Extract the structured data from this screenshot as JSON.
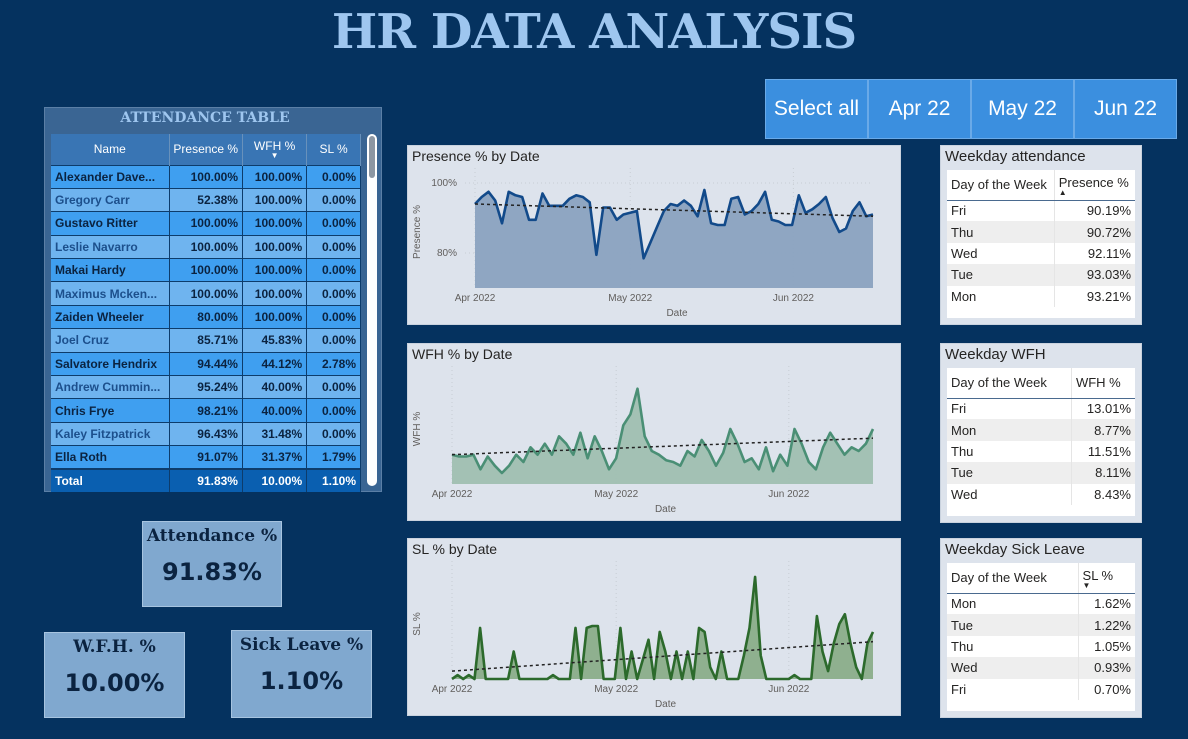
{
  "title": "HR DATA ANALYSIS",
  "slicer": [
    "Select all",
    "Apr 22",
    "May 22",
    "Jun 22"
  ],
  "attendance_table": {
    "title": "ATTENDANCE TABLE",
    "headers": [
      "Name",
      "Presence %",
      "WFH %",
      "SL %"
    ],
    "rows": [
      [
        "Alexander Dave...",
        "100.00%",
        "100.00%",
        "0.00%"
      ],
      [
        "Gregory Carr",
        "52.38%",
        "100.00%",
        "0.00%"
      ],
      [
        "Gustavo Ritter",
        "100.00%",
        "100.00%",
        "0.00%"
      ],
      [
        "Leslie Navarro",
        "100.00%",
        "100.00%",
        "0.00%"
      ],
      [
        "Makai Hardy",
        "100.00%",
        "100.00%",
        "0.00%"
      ],
      [
        "Maximus Mcken...",
        "100.00%",
        "100.00%",
        "0.00%"
      ],
      [
        "Zaiden Wheeler",
        "80.00%",
        "100.00%",
        "0.00%"
      ],
      [
        "Joel Cruz",
        "85.71%",
        "45.83%",
        "0.00%"
      ],
      [
        "Salvatore Hendrix",
        "94.44%",
        "44.12%",
        "2.78%"
      ],
      [
        "Andrew Cummin...",
        "95.24%",
        "40.00%",
        "0.00%"
      ],
      [
        "Chris Frye",
        "98.21%",
        "40.00%",
        "0.00%"
      ],
      [
        "Kaley Fitzpatrick",
        "96.43%",
        "31.48%",
        "0.00%"
      ],
      [
        "Ella Roth",
        "91.07%",
        "31.37%",
        "1.79%"
      ]
    ],
    "total": [
      "Total",
      "91.83%",
      "10.00%",
      "1.10%"
    ]
  },
  "kpis": {
    "attendance": {
      "label": "Attendance %",
      "value": "91.83%"
    },
    "wfh": {
      "label": "W.F.H. %",
      "value": "10.00%"
    },
    "sick": {
      "label": "Sick Leave %",
      "value": "1.10%"
    }
  },
  "chart_data": [
    {
      "type": "area",
      "title": "Presence % by Date",
      "xlabel": "Date",
      "ylabel": "Presence %",
      "x_ticks": [
        "Apr 2022",
        "May 2022",
        "Jun 2022"
      ],
      "y_ticks": [
        "100%",
        "80%"
      ],
      "ylim": [
        70,
        102
      ],
      "color": "#124a8a",
      "fill": "#8aa2c0",
      "trend": [
        94,
        90.5
      ],
      "values": [
        94,
        96,
        97.5,
        95,
        88.5,
        97.5,
        96.5,
        96,
        89.5,
        89.5,
        97,
        93.5,
        93.5,
        93.5,
        95.5,
        96.5,
        96,
        94.5,
        79.5,
        93,
        93,
        89.5,
        91,
        91.5,
        92,
        78.5,
        83,
        87.5,
        92,
        94,
        93.5,
        95,
        93.5,
        90.5,
        98,
        88.5,
        88,
        88,
        95.5,
        96,
        91,
        92,
        94,
        97.5,
        89.5,
        89,
        88,
        88,
        96.5,
        91.5,
        92.5,
        94,
        96,
        90,
        86,
        87,
        92,
        94.5,
        90.5,
        91
      ]
    },
    {
      "type": "area",
      "title": "WFH % by Date",
      "xlabel": "Date",
      "ylabel": "WFH %",
      "x_ticks": [
        "Apr 2022",
        "May 2022",
        "Jun 2022"
      ],
      "ylim": [
        0,
        30
      ],
      "color": "#4a8f75",
      "fill": "#9fbfb1",
      "trend": [
        8,
        12.5
      ],
      "values": [
        8,
        7.5,
        7.5,
        8,
        4,
        7.5,
        5,
        3,
        5,
        8,
        6,
        10,
        8,
        11,
        8,
        13,
        11,
        8,
        14,
        7,
        13,
        9,
        4,
        7,
        16,
        19,
        26,
        13,
        9,
        8,
        6.5,
        6,
        5,
        9,
        7.5,
        12,
        9,
        5,
        8.5,
        15,
        11,
        6,
        7,
        4,
        10,
        3.5,
        8,
        5,
        15,
        11,
        6,
        4,
        10,
        14,
        11,
        8,
        10,
        9,
        11,
        15
      ]
    },
    {
      "type": "area",
      "title": "SL % by Date",
      "xlabel": "Date",
      "ylabel": "SL %",
      "x_ticks": [
        "Apr 2022",
        "May 2022",
        "Jun 2022"
      ],
      "ylim": [
        0,
        2.8
      ],
      "color": "#2c6a2c",
      "fill": "#8aad8a",
      "trend": [
        0.2,
        0.95
      ],
      "values": [
        0,
        0.1,
        0,
        0.1,
        0,
        1.3,
        0,
        0,
        0,
        0,
        0,
        0.7,
        0,
        0,
        0,
        0,
        0,
        0,
        0.1,
        0,
        0,
        0,
        1.3,
        0,
        1.3,
        1.35,
        1.35,
        0,
        0,
        0,
        1.3,
        0,
        0.7,
        0,
        0.5,
        1.0,
        0,
        1.2,
        0.7,
        0,
        0.7,
        0,
        0.7,
        0,
        1.3,
        1.2,
        0.3,
        0,
        0.7,
        0,
        0,
        0,
        0.6,
        1.3,
        2.6,
        0.6,
        0,
        0,
        0,
        0,
        0,
        0.1,
        0,
        0,
        0,
        1.6,
        0.7,
        0.2,
        0.9,
        1.4,
        1.65,
        0.9,
        0.3,
        0,
        0.9,
        1.2
      ]
    }
  ],
  "weekday_attendance": {
    "title": "Weekday attendance",
    "headers": [
      "Day of the Week",
      "Presence %"
    ],
    "rows": [
      [
        "Fri",
        "90.19%"
      ],
      [
        "Thu",
        "90.72%"
      ],
      [
        "Wed",
        "92.11%"
      ],
      [
        "Tue",
        "93.03%"
      ],
      [
        "Mon",
        "93.21%"
      ]
    ]
  },
  "weekday_wfh": {
    "title": "Weekday WFH",
    "headers": [
      "Day of the Week",
      "WFH %"
    ],
    "rows": [
      [
        "Fri",
        "13.01%"
      ],
      [
        "Mon",
        "8.77%"
      ],
      [
        "Thu",
        "11.51%"
      ],
      [
        "Tue",
        "8.11%"
      ],
      [
        "Wed",
        "8.43%"
      ]
    ]
  },
  "weekday_sl": {
    "title": "Weekday Sick Leave",
    "headers": [
      "Day of the Week",
      "SL %"
    ],
    "rows": [
      [
        "Mon",
        "1.62%"
      ],
      [
        "Tue",
        "1.22%"
      ],
      [
        "Thu",
        "1.05%"
      ],
      [
        "Wed",
        "0.93%"
      ],
      [
        "Fri",
        "0.70%"
      ]
    ]
  }
}
